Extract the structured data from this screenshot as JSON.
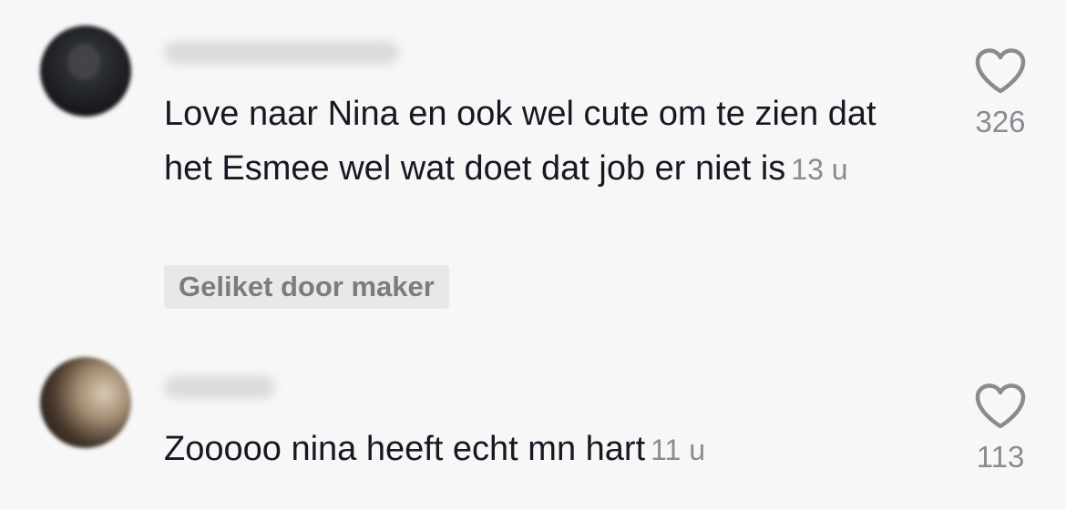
{
  "comments": [
    {
      "text": "Love naar Nina en ook wel cute om te zien dat het Esmee wel wat doet dat job er niet is",
      "timestamp": "13 u",
      "liked_badge": "Geliket door maker",
      "likes": "326",
      "like_icon": "heart-outline-icon"
    },
    {
      "text": "Zooooo nina heeft echt mn hart",
      "timestamp": "11 u",
      "likes": "113",
      "like_icon": "heart-outline-icon"
    }
  ],
  "colors": {
    "background": "#f7f7f7",
    "text": "#161823",
    "muted": "#8a8b91",
    "badge_bg": "#e8e8e8"
  }
}
